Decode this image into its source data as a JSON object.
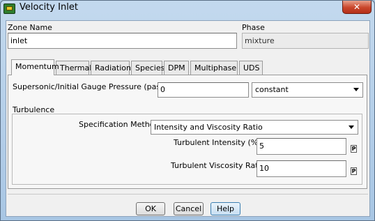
{
  "window": {
    "title": "Velocity Inlet",
    "icons": {
      "app": "fluent-app-icon",
      "close": "close-icon"
    }
  },
  "zone": {
    "label": "Zone Name",
    "value": "inlet"
  },
  "phase": {
    "label": "Phase",
    "value": "mixture"
  },
  "tabs": [
    {
      "label": "Momentum",
      "active": true
    },
    {
      "label": "Thermal"
    },
    {
      "label": "Radiation"
    },
    {
      "label": "Species"
    },
    {
      "label": "DPM"
    },
    {
      "label": "Multiphase"
    },
    {
      "label": "UDS"
    }
  ],
  "momentum": {
    "pressure_label": "Supersonic/Initial Gauge Pressure (pascal)",
    "pressure_value": "0",
    "pressure_method": "constant"
  },
  "turbulence": {
    "group_label": "Turbulence",
    "spec_label": "Specification Method",
    "spec_value": "Intensity and Viscosity Ratio",
    "intensity_label": "Turbulent Intensity (%)",
    "intensity_value": "5",
    "viscosity_label": "Turbulent Viscosity Ratio",
    "viscosity_value": "10",
    "param_button_label": "P"
  },
  "buttons": {
    "ok": "OK",
    "cancel": "Cancel",
    "help": "Help"
  }
}
